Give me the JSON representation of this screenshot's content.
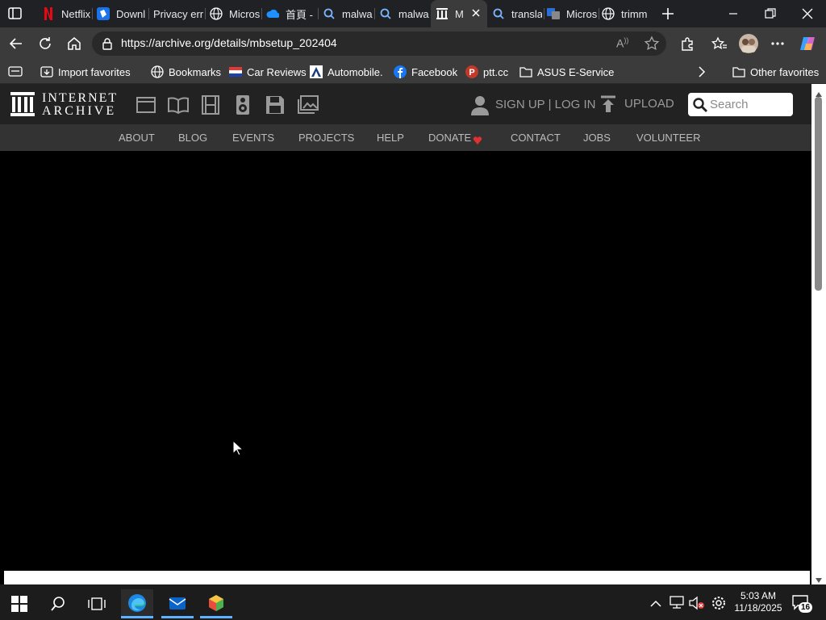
{
  "browser": {
    "tabs": [
      {
        "label": "Netflix",
        "icon": "netflix-icon"
      },
      {
        "label": "Downl",
        "icon": "download-app-icon"
      },
      {
        "label": "Privacy erro",
        "icon": "blank-icon"
      },
      {
        "label": "Micros",
        "icon": "globe-icon"
      },
      {
        "label": "首頁 -",
        "icon": "onedrive-icon"
      },
      {
        "label": "malwa",
        "icon": "search-icon"
      },
      {
        "label": "malwa",
        "icon": "search-icon"
      },
      {
        "label": "M",
        "icon": "internet-archive-icon",
        "active": true
      },
      {
        "label": "transla",
        "icon": "search-icon"
      },
      {
        "label": "Micros",
        "icon": "translator-icon"
      },
      {
        "label": "trimm",
        "icon": "globe-icon"
      }
    ],
    "url": "https://archive.org/details/mbsetup_202404",
    "bookmarks": [
      {
        "label": "Import favorites",
        "icon": "import-icon"
      },
      {
        "label": "Bookmarks",
        "icon": "globe-icon"
      },
      {
        "label": "Car Reviews",
        "icon": "car-reviews-icon"
      },
      {
        "label": "Automobile.",
        "icon": "automobile-icon"
      },
      {
        "label": "Facebook",
        "icon": "facebook-icon"
      },
      {
        "label": "ptt.cc",
        "icon": "ptt-icon"
      },
      {
        "label": "ASUS E-Service",
        "icon": "folder-icon"
      }
    ],
    "other_favorites": "Other favorites"
  },
  "archive": {
    "logo_line1": "INTERNET",
    "logo_line2": "ARCHIVE",
    "media_icons": [
      "web-icon",
      "texts-icon",
      "video-icon",
      "audio-icon",
      "software-icon",
      "images-icon"
    ],
    "signup": "SIGN UP | LOG IN",
    "upload": "UPLOAD",
    "search_placeholder": "Search",
    "nav": [
      "ABOUT",
      "BLOG",
      "EVENTS",
      "PROJECTS",
      "HELP",
      "DONATE",
      "CONTACT",
      "JOBS",
      "VOLUNTEER"
    ]
  },
  "taskbar": {
    "time": "5:03 AM",
    "date": "11/18/2025",
    "notifications": "16"
  },
  "colors": {
    "chrome_dark": "#202124",
    "toolbar": "#3b3b3b",
    "ia_header": "#222222",
    "ia_nav": "#333333",
    "donate_heart": "#e03030"
  }
}
